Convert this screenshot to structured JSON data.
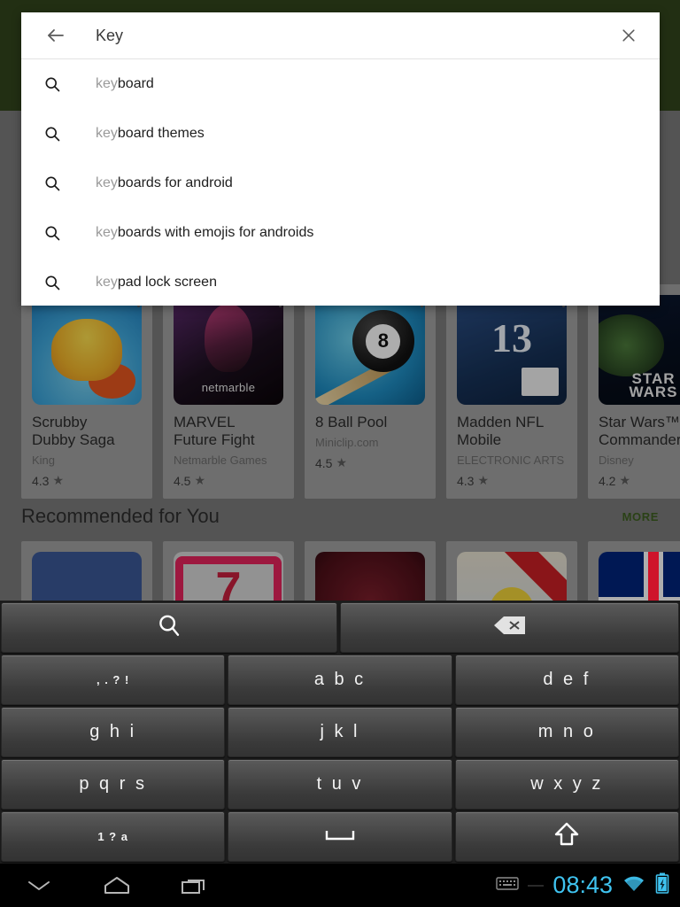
{
  "store": {
    "header_color": "#3b5222",
    "accent_green": "#3f6121",
    "games_shelf": [
      {
        "title": "Scrubby\nDubby Saga",
        "developer": "King",
        "rating": "4.3",
        "icon": "scrubby-dubby-saga-icon"
      },
      {
        "title": "MARVEL\nFuture Fight",
        "developer": "Netmarble Games",
        "rating": "4.5",
        "icon": "marvel-future-fight-icon"
      },
      {
        "title": "8 Ball Pool",
        "developer": "Miniclip.com",
        "rating": "4.5",
        "icon": "8-ball-pool-icon"
      },
      {
        "title": "Madden NFL\nMobile",
        "developer": "ELECTRONIC ARTS",
        "rating": "4.3",
        "icon": "madden-nfl-mobile-icon"
      },
      {
        "title": "Star Wars™\nCommander",
        "developer": "Disney",
        "rating": "4.2",
        "icon": "star-wars-commander-icon"
      }
    ],
    "recommended_section": {
      "title": "Recommended for You",
      "more_label": "MORE"
    },
    "recommended_shelf": [
      {
        "icon": "facebook-icon"
      },
      {
        "icon": "seven-app-icon"
      },
      {
        "icon": "bug-app-icon"
      },
      {
        "icon": "bee-app-icon"
      },
      {
        "icon": "uk-flag-app-icon"
      }
    ]
  },
  "search": {
    "query": "Key",
    "typed_prefix": "key",
    "back_icon": "back-arrow-icon",
    "clear_icon": "close-icon",
    "suggestion_icon": "search-icon",
    "suggestions": [
      {
        "prefix": "key",
        "rest": "board"
      },
      {
        "prefix": "key",
        "rest": "board themes"
      },
      {
        "prefix": "key",
        "rest": "boards for android"
      },
      {
        "prefix": "key",
        "rest": "boards with emojis for androids"
      },
      {
        "prefix": "key",
        "rest": "pad lock screen"
      }
    ]
  },
  "keyboard": {
    "rows": [
      [
        {
          "label": "",
          "name": "key-search",
          "icon": "search-icon",
          "style": "wide-search"
        },
        {
          "label": "",
          "name": "key-backspace",
          "icon": "backspace-icon",
          "style": "wide-del"
        }
      ],
      [
        {
          "label": ", . ? !",
          "name": "key-punctuation",
          "style": "small"
        },
        {
          "label": "a b c",
          "name": "key-abc"
        },
        {
          "label": "d e f",
          "name": "key-def"
        }
      ],
      [
        {
          "label": "g h i",
          "name": "key-ghi"
        },
        {
          "label": "j k l",
          "name": "key-jkl"
        },
        {
          "label": "m n o",
          "name": "key-mno"
        }
      ],
      [
        {
          "label": "p q r s",
          "name": "key-pqrs"
        },
        {
          "label": "t u v",
          "name": "key-tuv"
        },
        {
          "label": "w x y z",
          "name": "key-wxyz"
        }
      ],
      [
        {
          "label": "1 ? a",
          "name": "key-symbols",
          "style": "small"
        },
        {
          "label": "",
          "name": "key-space",
          "icon": "space-icon"
        },
        {
          "label": "",
          "name": "key-shift",
          "icon": "shift-up-icon"
        }
      ]
    ]
  },
  "system_bar": {
    "back_icon": "back-chevron-down-icon",
    "home_icon": "home-icon",
    "recents_icon": "recent-apps-icon",
    "keyboard_icon": "keyboard-indicator-icon",
    "time": "08:43",
    "wifi_icon": "wifi-icon",
    "battery_icon": "battery-charging-icon",
    "accent_color": "#3fc3f0"
  }
}
